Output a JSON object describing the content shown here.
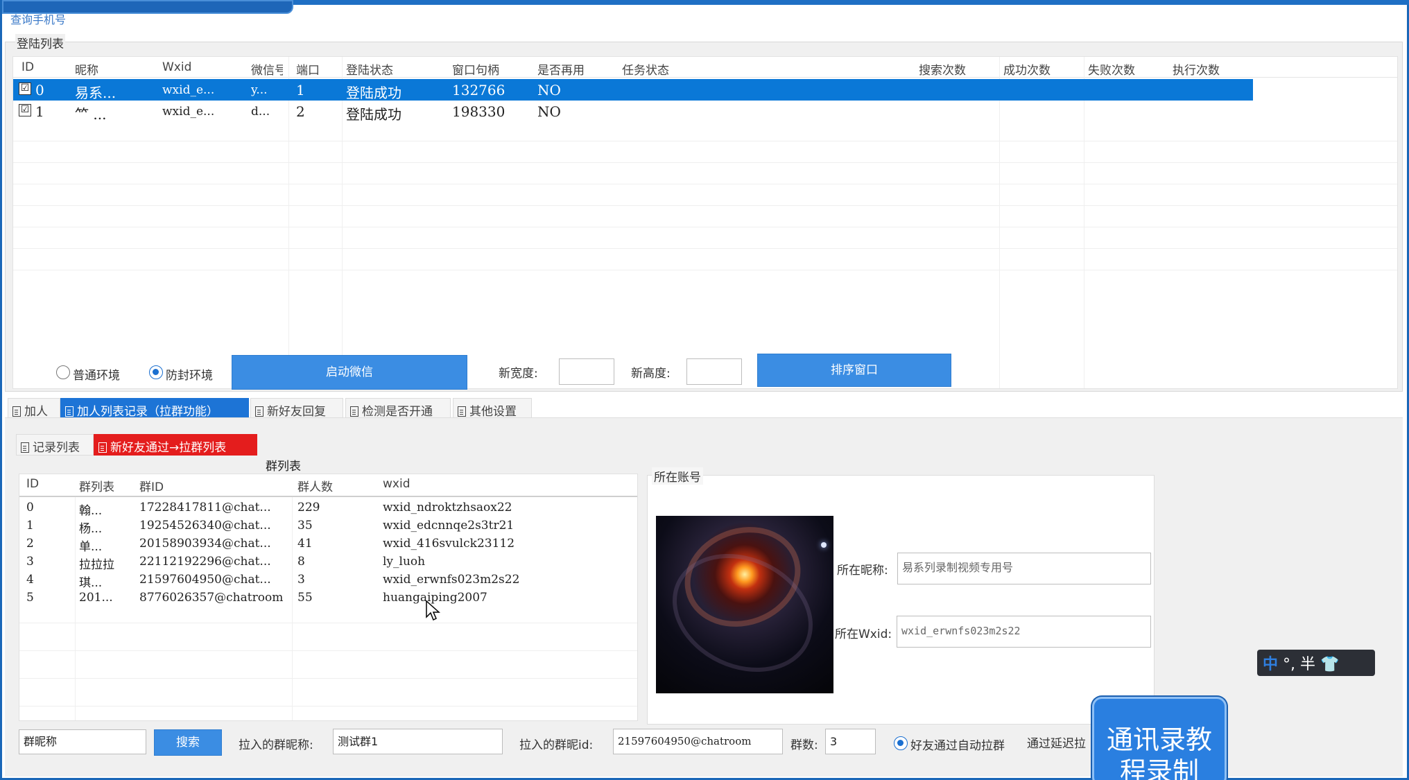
{
  "top_label": "查询手机号",
  "login_group": {
    "title": "登陆列表",
    "columns": [
      "ID",
      "昵称",
      "Wxid",
      "微信号",
      "端口",
      "登陆状态",
      "窗口句柄",
      "是否再用",
      "任务状态",
      "搜索次数",
      "成功次数",
      "失败次数",
      "执行次数"
    ],
    "rows": [
      {
        "checked": "☑",
        "id": "0",
        "nick": "易系...",
        "wxid": "wxid_e...",
        "wxno": "y...",
        "port": "1",
        "status": "登陆成功",
        "hwnd": "132766",
        "reuse": "NO",
        "task": "",
        "search": "",
        "success": "",
        "fail": "",
        "exec": ""
      },
      {
        "checked": "☑",
        "id": "1",
        "nick": "⺮    ...",
        "wxid": "wxid_e...",
        "wxno": "d...",
        "port": "2",
        "status": "登陆成功",
        "hwnd": "198330",
        "reuse": "NO",
        "task": "",
        "search": "",
        "success": "",
        "fail": "",
        "exec": ""
      }
    ],
    "selected_row": 0
  },
  "controls": {
    "env_normal": "普通环境",
    "env_protect": "防封环境",
    "env_selected": "防封环境",
    "start_button": "启动微信",
    "new_width_label": "新宽度:",
    "new_width_value": "",
    "new_height_label": "新高度:",
    "new_height_value": "",
    "sort_button": "排序窗口"
  },
  "main_tabs": [
    {
      "label": "加人",
      "active": false
    },
    {
      "label": "加人列表记录（拉群功能）",
      "active": true
    },
    {
      "label": "新好友回复",
      "active": false
    },
    {
      "label": "检测是否开通",
      "active": false
    },
    {
      "label": "其他设置",
      "active": false
    }
  ],
  "sub_tabs": [
    {
      "label": "记录列表",
      "active": false
    },
    {
      "label": "新好友通过→拉群列表",
      "active": true
    }
  ],
  "group_list": {
    "title": "群列表",
    "columns": [
      "ID",
      "群列表",
      "群ID",
      "群人数",
      "wxid"
    ],
    "rows": [
      {
        "id": "0",
        "name": "翰...",
        "gid": "17228417811@chat...",
        "count": "229",
        "wxid": "wxid_ndroktzhsaox22"
      },
      {
        "id": "1",
        "name": "杨...",
        "gid": "19254526340@chat...",
        "count": "35",
        "wxid": "wxid_edcnnqe2s3tr21"
      },
      {
        "id": "2",
        "name": "单...",
        "gid": "20158903934@chat...",
        "count": "41",
        "wxid": "wxid_416svulck23112"
      },
      {
        "id": "3",
        "name": "拉拉拉",
        "gid": "22112192296@chat...",
        "count": "8",
        "wxid": "ly_luoh"
      },
      {
        "id": "4",
        "name": "琪...",
        "gid": "21597604950@chat...",
        "count": "3",
        "wxid": "wxid_erwnfs023m2s22"
      },
      {
        "id": "5",
        "name": "201...",
        "gid": "8776026357@chatroom",
        "count": "55",
        "wxid": "huangaiping2007"
      }
    ]
  },
  "account": {
    "title": "所在账号",
    "nick_label": "所在昵称:",
    "nick_value": "易系列录制视频专用号",
    "wxid_label": "所在Wxid:",
    "wxid_value": "wxid_erwnfs023m2s22"
  },
  "bottom_bar": {
    "search_value": "群昵称",
    "search_button": "搜索",
    "pull_name_label": "拉入的群昵称:",
    "pull_name_value": "测试群1",
    "pull_id_label": "拉入的群昵id:",
    "pull_id_value": "21597604950@chatroom",
    "count_label": "群数:",
    "count_value": "3",
    "auto_pull_label": "好友通过自动拉群",
    "delay_label": "通过延迟拉"
  },
  "ime": {
    "mode": "中",
    "rest": "°, 半"
  },
  "popup": {
    "line1": "通讯录教",
    "line2": "程录制"
  }
}
